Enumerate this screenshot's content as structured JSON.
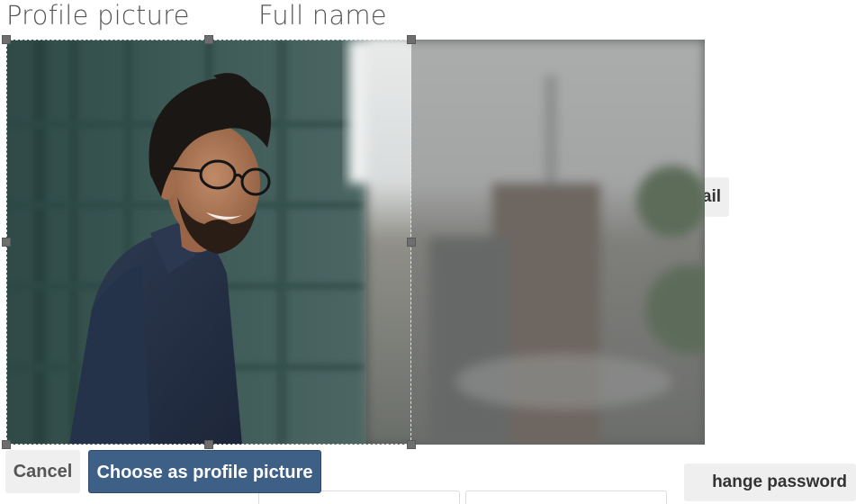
{
  "headings": {
    "profile_picture": "Profile picture",
    "full_name": "Full name"
  },
  "background_form": {
    "email_button_label": "ail",
    "change_password_label": "hange password"
  },
  "cropper": {
    "image_subject": "portrait-photo-man-smiling-glasses",
    "crop_shape": "square"
  },
  "actions": {
    "cancel_label": "Cancel",
    "choose_label": "Choose as profile picture"
  },
  "colors": {
    "primary_button": "#3e5f86",
    "secondary_button": "#efefef",
    "heading_text": "#555555"
  }
}
